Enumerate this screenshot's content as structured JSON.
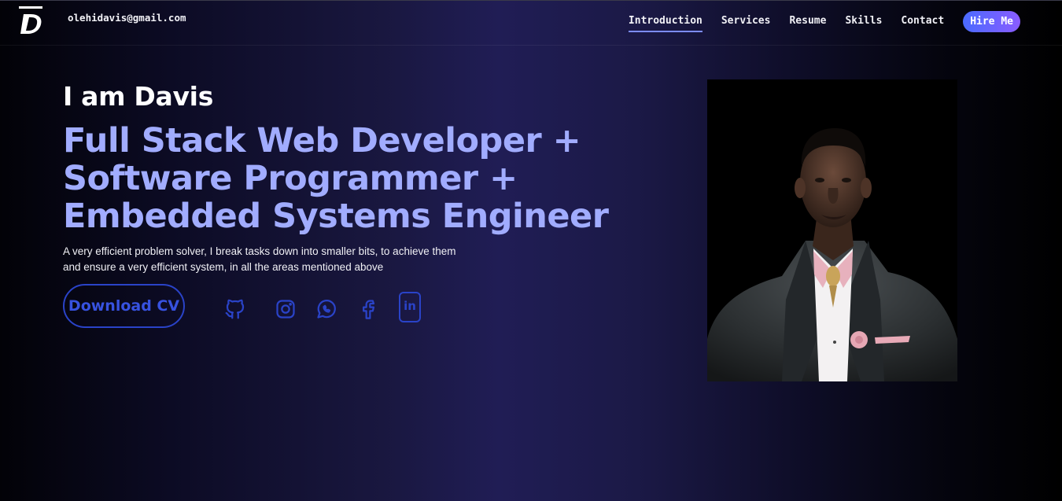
{
  "header": {
    "email": "olehidavis@gmail.com",
    "nav": [
      {
        "label": "Introduction",
        "active": true
      },
      {
        "label": "Services",
        "active": false
      },
      {
        "label": "Resume",
        "active": false
      },
      {
        "label": "Skills",
        "active": false
      },
      {
        "label": "Contact",
        "active": false
      }
    ],
    "hire_label": "Hire Me"
  },
  "hero": {
    "greeting": "I am Davis",
    "headline_lines": [
      "Full Stack Web Developer +",
      "Software Programmer +",
      "Embedded Systems Engineer"
    ],
    "description": "A very efficient problem solver, I break tasks down into smaller bits, to achieve them and ensure a very efficient system, in all the areas mentioned above",
    "download_label": "Download CV",
    "socials": [
      "github-icon",
      "instagram-icon",
      "whatsapp-icon",
      "facebook-icon",
      "linkedin-icon"
    ],
    "linkedin_text": "in"
  },
  "colors": {
    "accent": "#a1acff",
    "button_blue": "#2a43c8",
    "hire_gradient_start": "#4a6bff",
    "hire_gradient_end": "#8a5cff"
  }
}
